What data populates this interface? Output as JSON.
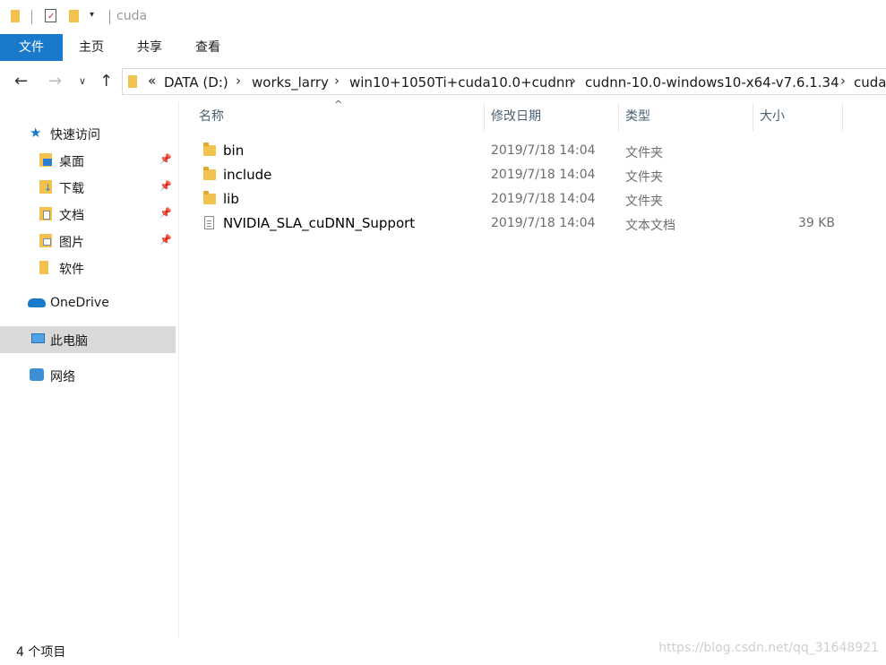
{
  "window": {
    "title": "cuda"
  },
  "ribbon": {
    "tabs": [
      "文件",
      "主页",
      "共享",
      "查看"
    ]
  },
  "address": {
    "overflow": "«",
    "crumbs": [
      "DATA (D:)",
      "works_larry",
      "win10+1050Ti+cuda10.0+cudnn",
      "cudnn-10.0-windows10-x64-v7.6.1.34",
      "cuda"
    ]
  },
  "sidebar": {
    "quick_access": "快速访问",
    "items": [
      {
        "label": "桌面",
        "icon": "desktop-icon",
        "pinned": true
      },
      {
        "label": "下载",
        "icon": "download-icon",
        "pinned": true
      },
      {
        "label": "文档",
        "icon": "documents-icon",
        "pinned": true
      },
      {
        "label": "图片",
        "icon": "pictures-icon",
        "pinned": true
      },
      {
        "label": "软件",
        "icon": "folder-icon",
        "pinned": false
      }
    ],
    "onedrive": "OneDrive",
    "this_pc": "此电脑",
    "network": "网络"
  },
  "columns": {
    "name": "名称",
    "modified": "修改日期",
    "type": "类型",
    "size": "大小"
  },
  "files": [
    {
      "name": "bin",
      "modified": "2019/7/18 14:04",
      "type": "文件夹",
      "size": "",
      "kind": "folder"
    },
    {
      "name": "include",
      "modified": "2019/7/18 14:04",
      "type": "文件夹",
      "size": "",
      "kind": "folder"
    },
    {
      "name": "lib",
      "modified": "2019/7/18 14:04",
      "type": "文件夹",
      "size": "",
      "kind": "folder"
    },
    {
      "name": "NVIDIA_SLA_cuDNN_Support",
      "modified": "2019/7/18 14:04",
      "type": "文本文档",
      "size": "39 KB",
      "kind": "text"
    }
  ],
  "status": {
    "count": "4 个项目",
    "watermark": "https://blog.csdn.net/qq_31648921"
  },
  "colors": {
    "accent": "#1979ca",
    "folder": "#f1c24e",
    "selected": "#d9d9d9"
  }
}
